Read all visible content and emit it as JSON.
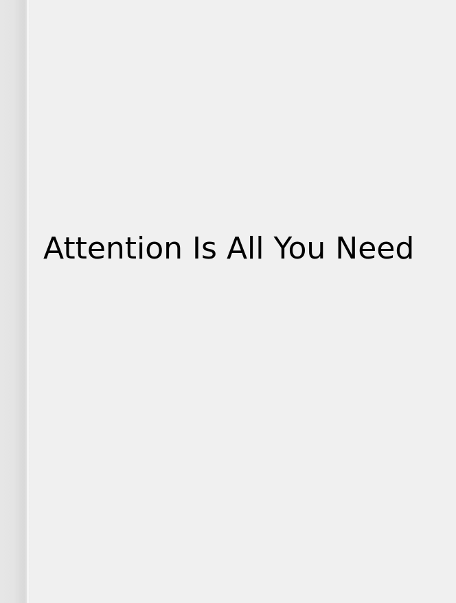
{
  "book": {
    "title": "Attention Is All You Need"
  },
  "colors": {
    "cover_background": "#f0f0f0",
    "spine_shade": "#d9d9d9",
    "title_text": "#000000"
  }
}
